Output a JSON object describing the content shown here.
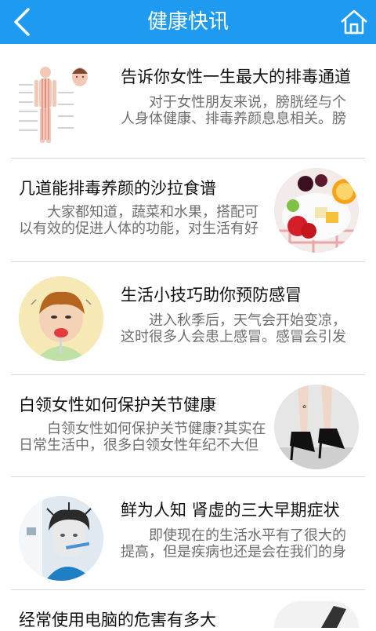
{
  "header": {
    "title": "健康快讯",
    "back_icon": "chevron-left-icon",
    "home_icon": "home-icon",
    "bg": "#1e9bf0"
  },
  "articles": [
    {
      "title": "告诉你女性一生最大的排毒通道",
      "desc_line1": "对于女性朋友来说，膀胱经与个",
      "desc_line2": "人身体健康、排毒养颜息息相关。膀"
    },
    {
      "title": "几道能排毒养颜的沙拉食谱",
      "desc_line1": "大家都知道，蔬菜和水果，搭配可",
      "desc_line2": "以有效的促进人体的功能，对生活有好"
    },
    {
      "title": "生活小技巧助你预防感冒",
      "desc_line1": "进入秋季后，天气会开始变凉，",
      "desc_line2": "这时很多人会患上感冒。感冒会引发"
    },
    {
      "title": "白领女性如何保护关节健康",
      "desc_line1": "白领女性如何保护关节健康?其实在",
      "desc_line2": "日常生活中，很多白领女性年纪不大但"
    },
    {
      "title": "鲜为人知 肾虚的三大早期症状",
      "desc_line1": "即使现在的生活水平有了很大的",
      "desc_line2": "提高，但是疾病也还是会在我们的身"
    },
    {
      "title": "经常使用电脑的危害有多大"
    }
  ]
}
